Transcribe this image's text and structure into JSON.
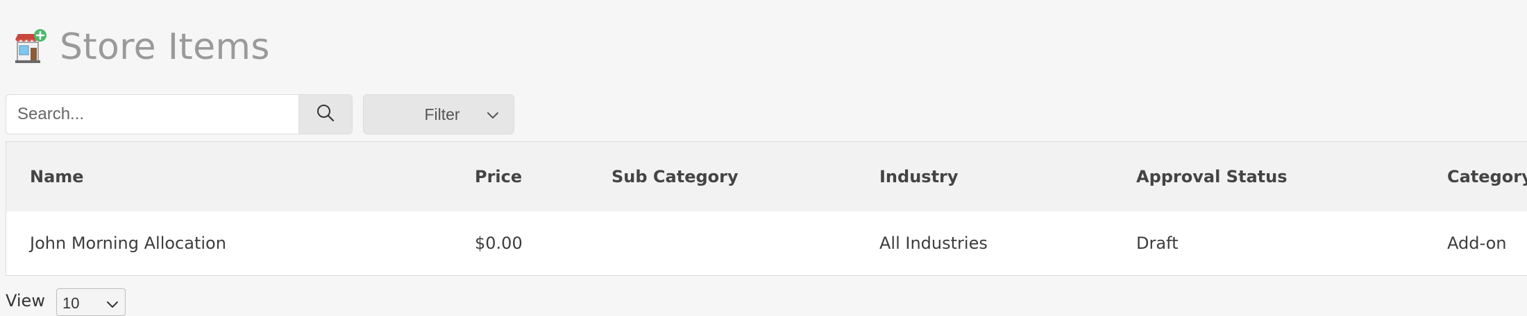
{
  "header": {
    "title": "Store Items",
    "icon": "store-add-icon"
  },
  "search": {
    "placeholder": "Search...",
    "value": "",
    "button_icon": "search-icon"
  },
  "filter": {
    "label": "Filter",
    "icon": "chevron-down-icon"
  },
  "table": {
    "columns": [
      "Name",
      "Price",
      "Sub Category",
      "Industry",
      "Approval Status",
      "Category"
    ],
    "rows": [
      {
        "name": "John Morning Allocation",
        "price": "$0.00",
        "sub_category": "",
        "industry": "All Industries",
        "approval_status": "Draft",
        "category": "Add-on"
      }
    ]
  },
  "pagination": {
    "view_label": "View",
    "page_size": "10"
  },
  "colors": {
    "background": "#f6f6f6",
    "title": "#9a9a9a",
    "header_bg": "#f2f2f2",
    "button_bg": "#e6e6e6"
  }
}
